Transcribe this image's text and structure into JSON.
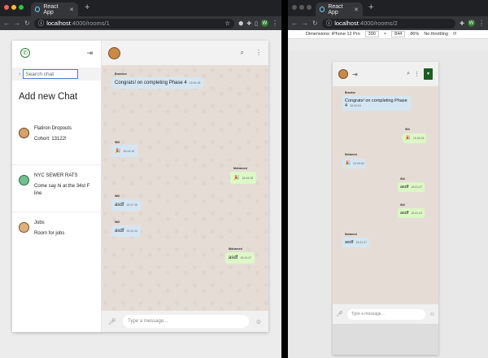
{
  "left_browser": {
    "tab_title": "React App",
    "url_host": "localhost",
    "url_path": ":4000/rooms/1",
    "profile_initial": "W"
  },
  "right_browser": {
    "tab_title": "React App",
    "url_host": "localhost",
    "url_path": ":4000/rooms/2",
    "profile_initial": "W",
    "devtools": {
      "dimensions": "Dimensions: iPhone 12 Pro",
      "width": "390",
      "height": "844",
      "zoom": "86%",
      "throttle": "No throttling"
    }
  },
  "sidebar": {
    "search_placeholder": "Search chat",
    "add_new_chat": "Add new Chat",
    "chats": [
      {
        "name": "Flatiron Dropouts",
        "last_message": "Cohort: 13122!"
      },
      {
        "name": "NYC SEWER RATS",
        "last_message": "Come say hi at the 34st F line"
      },
      {
        "name": "Jobs",
        "last_message": "Room for jobs"
      }
    ]
  },
  "desktop_chat": {
    "input_placeholder": "Type a message...",
    "messages": [
      {
        "sender": "Brandon",
        "text": "Congrats! on completing Phase 4",
        "time": "15:44:18",
        "dir": "in"
      },
      {
        "sender": "Will",
        "text": "🎉",
        "time": "15:44:18",
        "dir": "in"
      },
      {
        "sender": "Mohamed",
        "text": "🎉",
        "time": "15:44:18",
        "dir": "out"
      },
      {
        "sender": "Will",
        "text": "asdf",
        "time": "15:47:15",
        "dir": "in"
      },
      {
        "sender": "Will",
        "text": "asdf",
        "time": "15:41:24",
        "dir": "in"
      },
      {
        "sender": "Mohamed",
        "text": "asdf",
        "time": "15:41:27",
        "dir": "out"
      }
    ]
  },
  "mobile_chat": {
    "input_placeholder": "Type a message...",
    "messages": [
      {
        "sender": "Brandon",
        "text": "Congrats! on completing Phase 4",
        "time": "15:44:18",
        "dir": "in"
      },
      {
        "sender": "Will",
        "text": "🎉",
        "time": "15:44:18",
        "dir": "out"
      },
      {
        "sender": "Mohamed",
        "text": "🎉",
        "time": "15:44:18",
        "dir": "in"
      },
      {
        "sender": "Will",
        "text": "asdf",
        "time": "15:41:27",
        "dir": "out"
      },
      {
        "sender": "Will",
        "text": "asdf",
        "time": "15:41:24",
        "dir": "out"
      },
      {
        "sender": "Mohamed",
        "text": "asdf",
        "time": "15:41:27",
        "dir": "in"
      }
    ]
  },
  "icons": {
    "whatsapp": "whatsapp-icon",
    "logout": "logout-icon",
    "search": "search-icon",
    "more": "more-vert-icon",
    "mic": "mic-icon",
    "emoji": "emoji-icon"
  },
  "colors": {
    "chat_bg": "#e5ddd5",
    "incoming": "#d5e6f3",
    "outgoing": "#dcf8c6",
    "brand_green": "#2e7d32"
  }
}
